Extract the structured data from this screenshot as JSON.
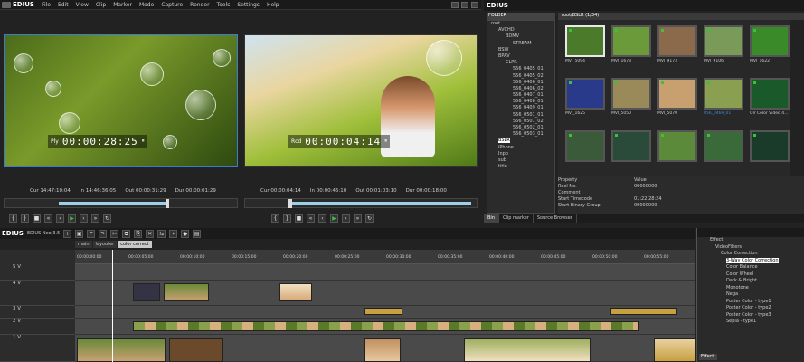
{
  "menubar": {
    "app": "EDIUS",
    "items": [
      "File",
      "Edit",
      "View",
      "Clip",
      "Marker",
      "Mode",
      "Capture",
      "Render",
      "Tools",
      "Settings",
      "Help"
    ]
  },
  "player": {
    "tc_label": "Ply",
    "tc": "00:00:28:25",
    "cur": "Cur 14:47:10:04",
    "in": "In 14:46:36:05",
    "out": "Out 00:00:31:29",
    "dur": "Dur 00:00:01:29"
  },
  "recorder": {
    "tc_label": "Rcd",
    "tc": "00:00:04:14",
    "cur": "Cur 00:00:04:14",
    "in": "In 00:00:45:10",
    "out": "Out 00:01:03:10",
    "dur": "Dur 00:00:18:00"
  },
  "bin_window": {
    "title": "EDIUS",
    "folder_header": "FOLDER",
    "bin_header": "root/BSLR (1/34)",
    "folders": [
      "root",
      "AVCHD",
      "BDMV",
      "STREAM",
      "BSW",
      "BPAV",
      "CLPR",
      "556_0405_01",
      "556_0405_02",
      "556_0406_01",
      "556_0406_02",
      "556_0407_01",
      "556_0408_01",
      "556_0409_01",
      "556_0501_01",
      "556_0501_02",
      "556_0502_01",
      "556_0503_01",
      "BSLR",
      "iPhone",
      "Inpo",
      "sub",
      "title"
    ],
    "selected_folder": "BSLR",
    "clips": [
      {
        "name": "MVI_5094"
      },
      {
        "name": "MVI_1673"
      },
      {
        "name": "MVI_9173"
      },
      {
        "name": "MVI_9106"
      },
      {
        "name": "MVI_1622"
      },
      {
        "name": "MVI_1625"
      },
      {
        "name": "MVI_5050"
      },
      {
        "name": "MVI_5070"
      },
      {
        "name": "056_0469_01"
      },
      {
        "name": "GV Color Video 4..."
      },
      {
        "name": ""
      },
      {
        "name": ""
      },
      {
        "name": ""
      },
      {
        "name": ""
      },
      {
        "name": ""
      }
    ],
    "properties": [
      [
        "Property",
        "Value"
      ],
      [
        "Reel No.",
        "00000000"
      ],
      [
        "Comment",
        ""
      ],
      [
        "Start Timecode",
        "01:22:28:24"
      ],
      [
        "Start Binary Group",
        "00000000"
      ]
    ],
    "tabs": [
      "Bin",
      "Clip marker",
      "Source Browser"
    ]
  },
  "timeline": {
    "title": "EDIUS",
    "project": "EDIUS Neo 3.5",
    "seq_tabs": [
      "main",
      "layouter",
      "color correct"
    ],
    "ruler": [
      "00:00:00:00",
      "00:00:05:00",
      "00:00:10:00",
      "00:00:15:00",
      "00:00:20:00",
      "00:00:25:00",
      "00:00:30:00",
      "00:00:35:00",
      "00:00:40:00",
      "00:00:45:00",
      "00:00:50:00",
      "00:00:55:00",
      "00:01:00:00"
    ],
    "tracks": [
      "5 V",
      "4 V",
      "3 V",
      "2 V",
      "1 V"
    ]
  },
  "effect": {
    "tree": [
      "Effect",
      "VideoFilters",
      "Color Correction",
      "3-Way Color Correction",
      "Color Balance",
      "Color Wheel",
      "Dark & Bright",
      "Monotone",
      "Nega",
      "Poster Color - type1",
      "Poster Color - type2",
      "Poster Color - type3",
      "Sepia - type1"
    ],
    "selected": "3-Way Color Correction",
    "tab": "Effect"
  }
}
